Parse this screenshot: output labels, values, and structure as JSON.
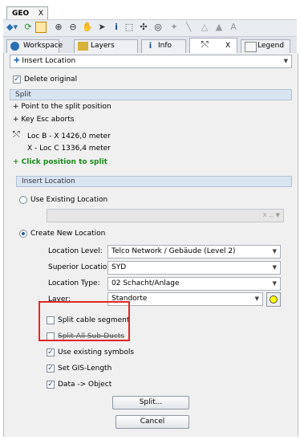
{
  "window": {
    "tab_title": "GEO",
    "close_glyph": "X"
  },
  "toolbar": {
    "icons": [
      "layers-dropdown-icon",
      "refresh-icon",
      "window-icon",
      "zoom-in-icon",
      "zoom-out-icon",
      "pan-hand-icon",
      "select-arrow-icon",
      "info-icon",
      "select-box-icon",
      "node-icon",
      "node-select-icon",
      "pin-icon",
      "line-icon",
      "polygon-icon",
      "fill-icon",
      "text-icon"
    ]
  },
  "tabs": [
    {
      "label": "Workspace"
    },
    {
      "label": "Layers"
    },
    {
      "label": "Info"
    },
    {
      "label": ""
    },
    {
      "label": "Legend"
    }
  ],
  "tab_close_glyph": "X",
  "mode_combo": {
    "value": "Insert Location"
  },
  "delete_original": {
    "label": "Delete original",
    "checked": true
  },
  "split": {
    "header": "Split",
    "line1": "+ Point to the split position",
    "line2": "+ Key Esc aborts",
    "loc_b": "Loc B - X  1426,0 meter",
    "loc_c": "X - Loc C  1336,4 meter",
    "click_hint": "+ Click position to split"
  },
  "insert": {
    "header": "Insert Location",
    "use_existing": {
      "label": "Use Existing Location",
      "selected": false
    },
    "existing_combo_controls": "X ... ▼",
    "create_new": {
      "label": "Create New Location",
      "selected": true
    },
    "fields": {
      "level_label": "Location Level:",
      "level_value": "Telco Network / Gebäude (Level 2)",
      "superior_label": "Superior Location:",
      "superior_value": "SYD",
      "type_label": "Location Type:",
      "type_value": "02 Schacht/Anlage",
      "layer_label": "Layer:",
      "layer_value": "Standorte"
    },
    "options": {
      "split_cable": "Split cable segment",
      "split_all": "Split All Sub-Ducts",
      "use_symbols": "Use existing symbols",
      "gis_length": "Set GIS-Length",
      "data_object": "Data -> Object"
    },
    "checked": {
      "split_cable": false,
      "split_all": false,
      "use_symbols": true,
      "gis_length": true,
      "data_object": true
    }
  },
  "buttons": {
    "split": "Split...",
    "cancel": "Cancel"
  },
  "colors": {
    "accent": "#e0262a",
    "green": "#1a8a1a",
    "layer_swatch": "#ffff00"
  }
}
